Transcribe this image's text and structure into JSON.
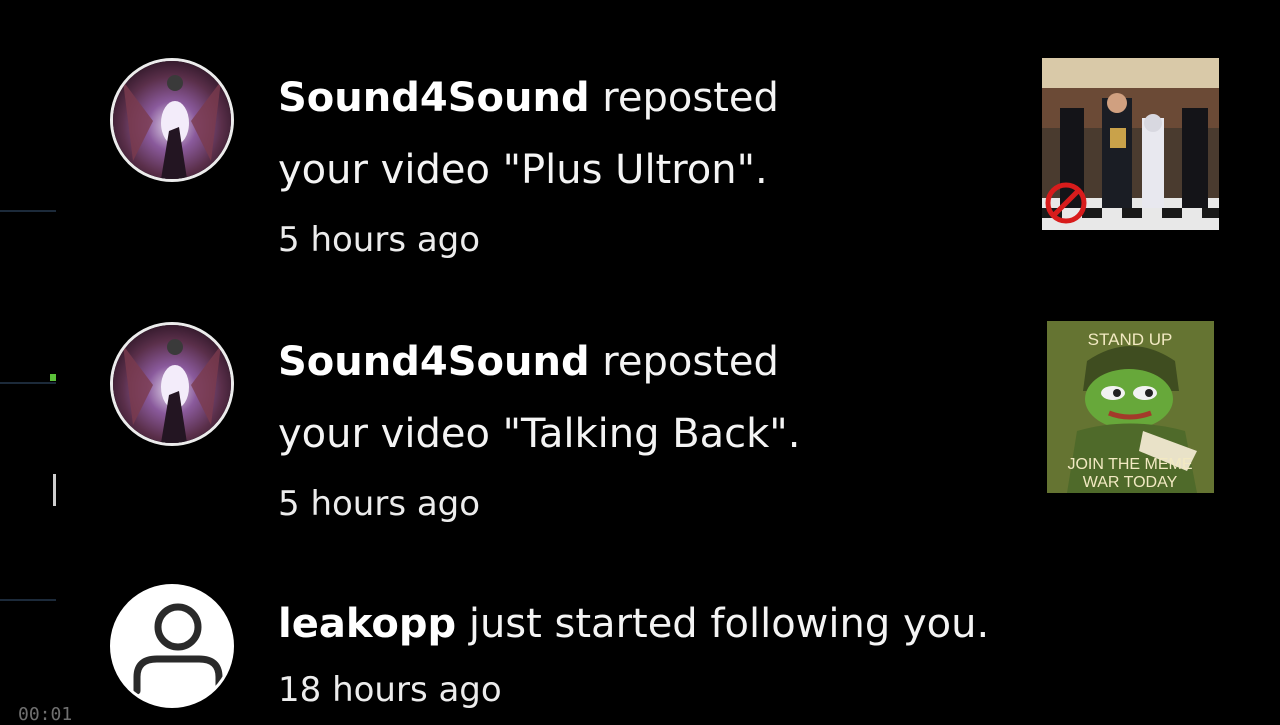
{
  "notifications": [
    {
      "username": "Sound4Sound",
      "action": " reposted",
      "line2": "your video \"Plus Ultron\".",
      "time": "5 hours ago",
      "avatar_icon": "hooded-figure-avatar",
      "thumbnail_icon": "ceremony-photo-thumbnail"
    },
    {
      "username": "Sound4Sound",
      "action": " reposted",
      "line2": "your video \"Talking Back\".",
      "time": "5 hours ago",
      "avatar_icon": "hooded-figure-avatar",
      "thumbnail_icon": "pepe-meme-thumbnail",
      "thumbnail_text_top": "STAND UP",
      "thumbnail_text_bottom_1": "JOIN THE MEME",
      "thumbnail_text_bottom_2": "WAR TODAY"
    },
    {
      "username": "leakopp",
      "action": " just started following you.",
      "time": "18 hours ago",
      "avatar_icon": "default-user-icon"
    }
  ],
  "player": {
    "timecode": "00:01"
  },
  "colors": {
    "background": "#000000",
    "text": "#f4f4f4",
    "accent_dot": "#5cc13a"
  }
}
